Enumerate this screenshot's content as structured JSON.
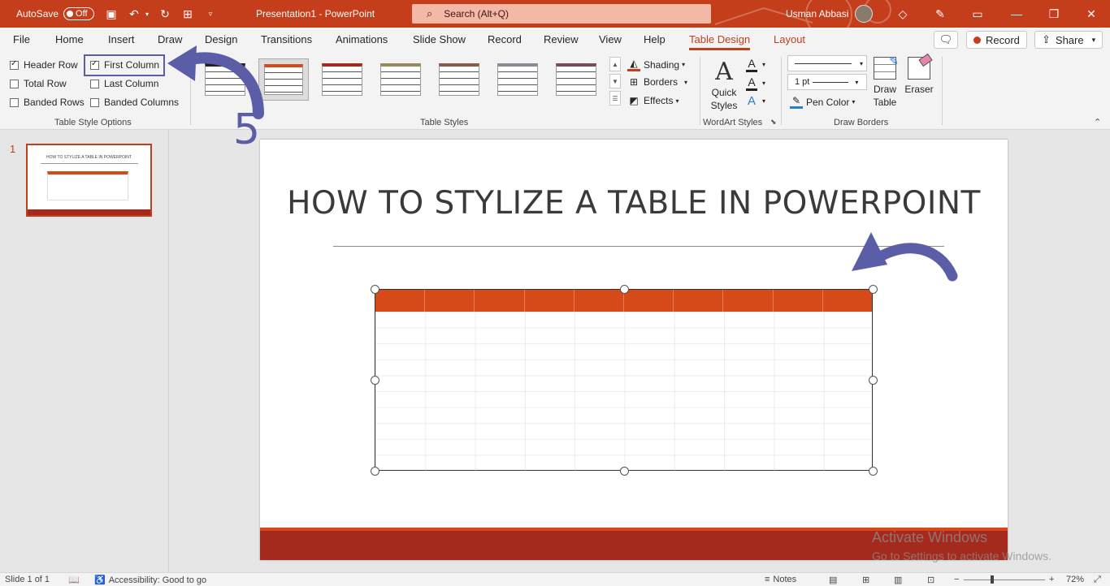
{
  "titlebar": {
    "autosave_label": "AutoSave",
    "autosave_state": "Off",
    "doc_title": "Presentation1  -  PowerPoint",
    "search_placeholder": "Search (Alt+Q)",
    "user_name": "Usman Abbasi"
  },
  "tabs": [
    "File",
    "Home",
    "Insert",
    "Draw",
    "Design",
    "Transitions",
    "Animations",
    "Slide Show",
    "Record",
    "Review",
    "View",
    "Help",
    "Table Design",
    "Layout"
  ],
  "active_tab": "Table Design",
  "tab_buttons": {
    "record": "Record",
    "share": "Share"
  },
  "ribbon": {
    "table_style_options": {
      "label": "Table Style Options",
      "checkboxes": [
        {
          "label": "Header Row",
          "checked": true
        },
        {
          "label": "First Column",
          "checked": true
        },
        {
          "label": "Total Row",
          "checked": false
        },
        {
          "label": "Last Column",
          "checked": false
        },
        {
          "label": "Banded Rows",
          "checked": false
        },
        {
          "label": "Banded Columns",
          "checked": false
        }
      ]
    },
    "table_styles": {
      "label": "Table Styles",
      "thumb_colors": [
        "#222222",
        "#d64a1a",
        "#a52a1e",
        "#9c8a5b",
        "#8b5a4a",
        "#8b8b98",
        "#7b4a5a"
      ],
      "shading": "Shading",
      "borders": "Borders",
      "effects": "Effects"
    },
    "wordart": {
      "label": "WordArt Styles",
      "quick_styles": "Quick Styles"
    },
    "draw_borders": {
      "label": "Draw Borders",
      "pen_weight": "1 pt",
      "pen_color": "Pen Color",
      "draw_table": "Draw Table",
      "eraser": "Eraser"
    }
  },
  "annotation": {
    "step_number": "5",
    "color": "#5b5ea6"
  },
  "thumbnail": {
    "number": "1",
    "mini_title": "HOW TO STYLIZE A TABLE IN POWERPOINT"
  },
  "slide": {
    "title": "HOW TO STYLIZE A TABLE IN POWERPOINT",
    "table_header_color": "#d64a1a",
    "footer_color": "#a52a1e"
  },
  "watermark": {
    "line1": "Activate Windows",
    "line2": "Go to Settings to activate Windows."
  },
  "status": {
    "slide_count": "Slide 1 of 1",
    "accessibility": "Accessibility: Good to go",
    "notes": "Notes",
    "zoom": "72%"
  },
  "colors": {
    "accent": "#c43e1c",
    "highlight": "#5b5ea6"
  }
}
